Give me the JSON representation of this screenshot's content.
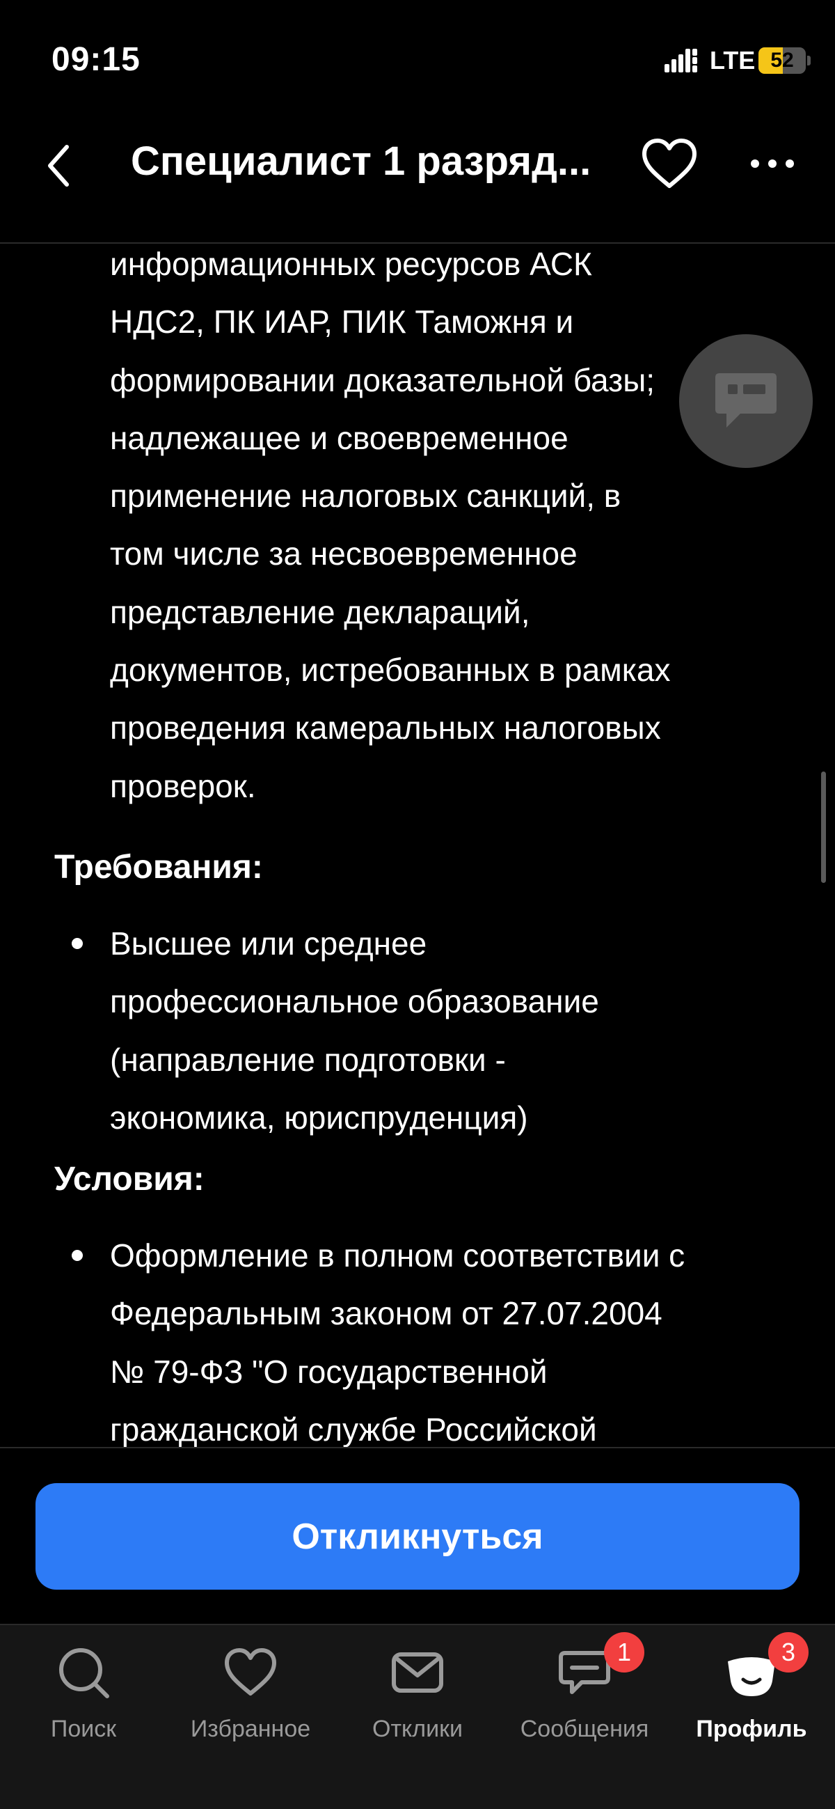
{
  "status_bar": {
    "time": "09:15",
    "network": "LTE",
    "battery_level": "52",
    "battery_fraction": 0.52,
    "battery_color": "#f5c518"
  },
  "header": {
    "title": "Специалист 1 разряд...",
    "icons": [
      "back-icon",
      "favorite-icon",
      "more-icon"
    ]
  },
  "content": {
    "continued_lines": [
      "информационных ресурсов АСК",
      "НДС2, ПК ИАР, ПИК Таможня и",
      "формировании доказательной базы;",
      "надлежащее и своевременное",
      "применение налоговых санкций, в",
      "том числе за несвоевременное",
      "представление деклараций,",
      "документов, истребованных в рамках",
      "проведения камеральных налоговых",
      "проверок."
    ],
    "requirements_heading": "Требования:",
    "requirements_lines": [
      "Высшее или среднее",
      "профессиональное образование",
      "(направление подготовки -",
      "экономика, юриспруденция)"
    ],
    "conditions_heading": "Условия:",
    "conditions_lines": [
      "Оформление в полном соответствии с",
      "Федеральным законом от 27.07.2004",
      "№ 79-ФЗ \"О государственной",
      "гражданской службе Российской"
    ]
  },
  "apply": {
    "label": "Откликнуться",
    "color": "#2d7bf6"
  },
  "tab_bar": {
    "tabs": [
      {
        "label": "Поиск",
        "icon": "search-icon",
        "active": false
      },
      {
        "label": "Избранное",
        "icon": "heart-icon",
        "active": false
      },
      {
        "label": "Отклики",
        "icon": "envelope-icon",
        "active": false
      },
      {
        "label": "Сообщения",
        "icon": "chat-icon",
        "active": false,
        "badge": "1"
      },
      {
        "label": "Профиль",
        "icon": "profile-icon",
        "active": true,
        "badge": "3"
      }
    ]
  }
}
